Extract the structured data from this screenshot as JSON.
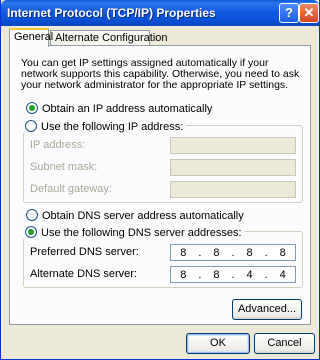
{
  "window": {
    "title": "Internet Protocol (TCP/IP) Properties",
    "help_glyph": "?",
    "close_glyph": "✕"
  },
  "tabs": [
    {
      "label": "General",
      "active": true
    },
    {
      "label": "Alternate Configuration",
      "active": false
    }
  ],
  "intro_text": "You can get IP settings assigned automatically if your network supports this capability. Otherwise, you need to ask your network administrator for the appropriate IP settings.",
  "ip": {
    "auto_label": "Obtain an IP address automatically",
    "manual_label": "Use the following IP address:",
    "selected": "auto",
    "fields": [
      {
        "label": "IP address:",
        "value": [
          "",
          "",
          "",
          ""
        ]
      },
      {
        "label": "Subnet mask:",
        "value": [
          "",
          "",
          "",
          ""
        ]
      },
      {
        "label": "Default gateway:",
        "value": [
          "",
          "",
          "",
          ""
        ]
      }
    ]
  },
  "dns": {
    "auto_label": "Obtain DNS server address automatically",
    "manual_label": "Use the following DNS server addresses:",
    "selected": "manual",
    "preferred_label": "Preferred DNS server:",
    "preferred_value": [
      "8",
      "8",
      "8",
      "8"
    ],
    "alternate_label": "Alternate DNS server:",
    "alternate_value": [
      "8",
      "8",
      "4",
      "4"
    ]
  },
  "buttons": {
    "advanced": "Advanced...",
    "ok": "OK",
    "cancel": "Cancel"
  },
  "colors": {
    "titlebar": "#0a4fd3",
    "dialog_bg": "#ece9d8",
    "tab_highlight": "#ffc83c",
    "radio_selected": "#21a121"
  }
}
